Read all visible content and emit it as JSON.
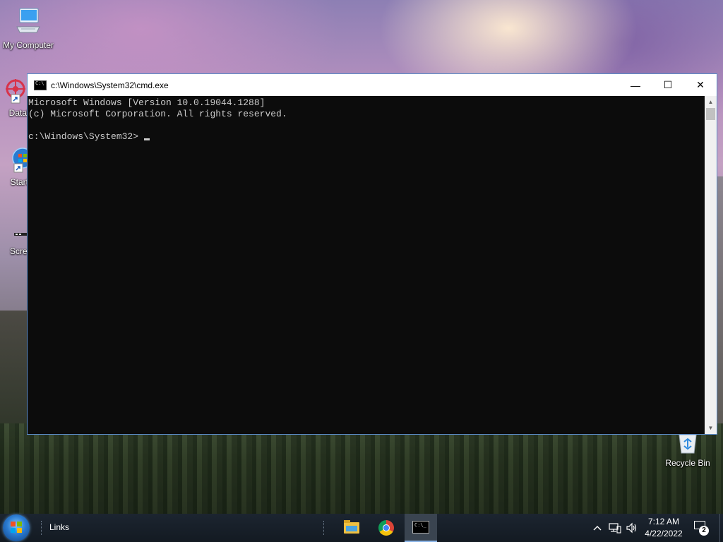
{
  "desktop": {
    "icons": [
      {
        "label": "My Computer"
      },
      {
        "label": "DataW"
      },
      {
        "label": "Start M"
      },
      {
        "label": "Screen"
      },
      {
        "label": "Recycle Bin"
      }
    ]
  },
  "window": {
    "title": "c:\\Windows\\System32\\cmd.exe",
    "controls": {
      "minimize": "—",
      "maximize": "☐",
      "close": "✕"
    },
    "console_lines": [
      "Microsoft Windows [Version 10.0.19044.1288]",
      "(c) Microsoft Corporation. All rights reserved.",
      "",
      "c:\\Windows\\System32>"
    ]
  },
  "taskbar": {
    "links_label": "Links",
    "apps": [
      {
        "name": "File Explorer",
        "icon": "folder-icon"
      },
      {
        "name": "Google Chrome",
        "icon": "chrome-icon"
      },
      {
        "name": "Command Prompt",
        "icon": "cmd-icon",
        "active": true
      }
    ],
    "tray": {
      "chevron": "^",
      "network_icon": "network-icon",
      "volume_icon": "volume-icon"
    },
    "clock": {
      "time": "7:12 AM",
      "date": "4/22/2022"
    },
    "notifications": {
      "count": "2"
    }
  },
  "colors": {
    "console_bg": "#0c0c0c",
    "console_fg": "#cccccc",
    "taskbar_bg": "#131a22",
    "window_border": "#5b8bc6"
  }
}
